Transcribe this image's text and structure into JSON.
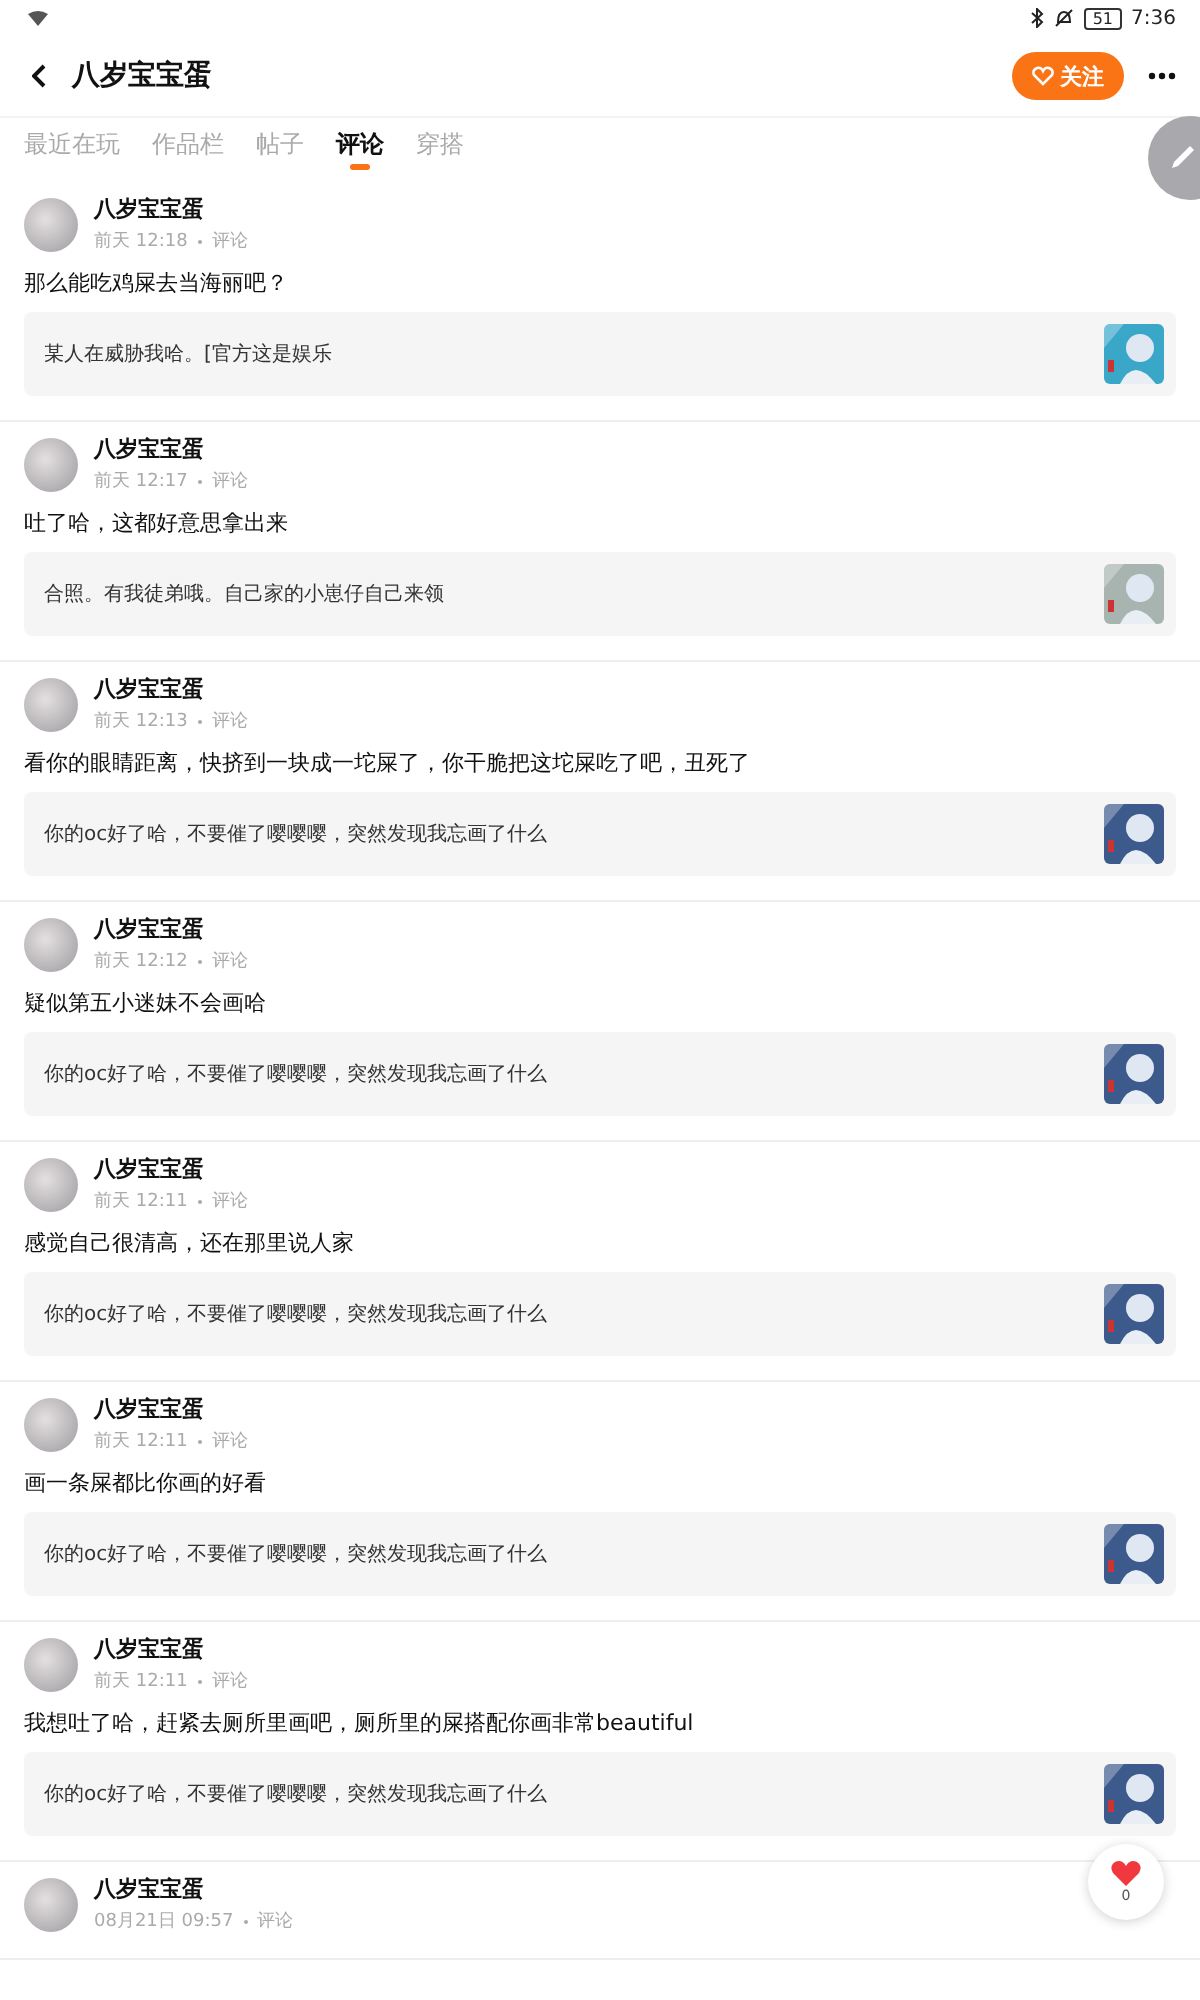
{
  "status_bar": {
    "battery": "51",
    "time": "7:36"
  },
  "header": {
    "title": "八岁宝宝蛋",
    "follow_button": "关注"
  },
  "tabs": [
    {
      "label": "最近在玩",
      "selected": false
    },
    {
      "label": "作品栏",
      "selected": false
    },
    {
      "label": "帖子",
      "selected": false
    },
    {
      "label": "评论",
      "selected": true
    },
    {
      "label": "穿搭",
      "selected": false
    }
  ],
  "comments": [
    {
      "author": "八岁宝宝蛋",
      "time": "前天 12:18",
      "type": "评论",
      "text": "那么能吃鸡屎去当海丽吧？",
      "quote": "某人在威胁我哈。[官方这是娱乐"
    },
    {
      "author": "八岁宝宝蛋",
      "time": "前天 12:17",
      "type": "评论",
      "text": "吐了哈，这都好意思拿出来",
      "quote": "合照。有我徒弟哦。自己家的小崽仔自己来领"
    },
    {
      "author": "八岁宝宝蛋",
      "time": "前天 12:13",
      "type": "评论",
      "text": "看你的眼睛距离，快挤到一块成一坨屎了，你干脆把这坨屎吃了吧，丑死了",
      "quote": "你的oc好了哈，不要催了嘤嘤嘤，突然发现我忘画了什么"
    },
    {
      "author": "八岁宝宝蛋",
      "time": "前天 12:12",
      "type": "评论",
      "text": "疑似第五小迷妹不会画哈",
      "quote": "你的oc好了哈，不要催了嘤嘤嘤，突然发现我忘画了什么"
    },
    {
      "author": "八岁宝宝蛋",
      "time": "前天 12:11",
      "type": "评论",
      "text": "感觉自己很清高，还在那里说人家",
      "quote": "你的oc好了哈，不要催了嘤嘤嘤，突然发现我忘画了什么"
    },
    {
      "author": "八岁宝宝蛋",
      "time": "前天 12:11",
      "type": "评论",
      "text": "画一条屎都比你画的好看",
      "quote": "你的oc好了哈，不要催了嘤嘤嘤，突然发现我忘画了什么"
    },
    {
      "author": "八岁宝宝蛋",
      "time": "前天 12:11",
      "type": "评论",
      "text": "我想吐了哈，赶紧去厕所里画吧，厕所里的屎搭配你画非常beautiful",
      "quote": "你的oc好了哈，不要催了嘤嘤嘤，突然发现我忘画了什么"
    },
    {
      "author": "八岁宝宝蛋",
      "time": "08月21日 09:57",
      "type": "评论"
    }
  ],
  "like_button": {
    "count": "0"
  }
}
